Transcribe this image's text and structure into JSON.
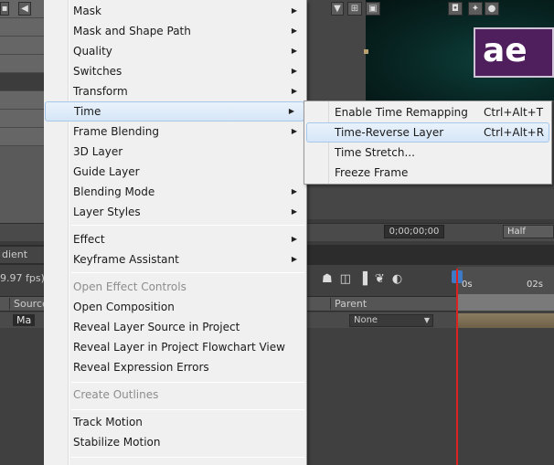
{
  "background": {
    "fps_label": "9.97 fps)",
    "panel_tab": "dient",
    "timecode": "0;00;00;00",
    "resolution": "Half",
    "columns": {
      "source": "Source",
      "parent": "Parent"
    },
    "layer_name": "Ma",
    "parent_value": "None",
    "ruler": {
      "start": "0s",
      "mark": "02s"
    },
    "logo_text": "ae"
  },
  "context_menu": {
    "items": [
      {
        "label": "Mask",
        "submenu": true
      },
      {
        "label": "Mask and Shape Path",
        "submenu": true
      },
      {
        "label": "Quality",
        "submenu": true
      },
      {
        "label": "Switches",
        "submenu": true
      },
      {
        "label": "Transform",
        "submenu": true
      },
      {
        "label": "Time",
        "submenu": true,
        "highlighted": true
      },
      {
        "label": "Frame Blending",
        "submenu": true
      },
      {
        "label": "3D Layer"
      },
      {
        "label": "Guide Layer"
      },
      {
        "label": "Blending Mode",
        "submenu": true
      },
      {
        "label": "Layer Styles",
        "submenu": true
      },
      {
        "label": "Effect",
        "submenu": true
      },
      {
        "label": "Keyframe Assistant",
        "submenu": true
      },
      {
        "label": "Open Effect Controls",
        "disabled": true
      },
      {
        "label": "Open Composition"
      },
      {
        "label": "Reveal Layer Source in Project"
      },
      {
        "label": "Reveal Layer in Project Flowchart View"
      },
      {
        "label": "Reveal Expression Errors"
      },
      {
        "label": "Create Outlines",
        "disabled": true
      },
      {
        "label": "Track Motion"
      },
      {
        "label": "Stabilize Motion"
      }
    ]
  },
  "time_submenu": {
    "items": [
      {
        "label": "Enable Time Remapping",
        "shortcut": "Ctrl+Alt+T"
      },
      {
        "label": "Time-Reverse Layer",
        "shortcut": "Ctrl+Alt+R",
        "highlighted": true
      },
      {
        "label": "Time Stretch...",
        "shortcut": ""
      },
      {
        "label": "Freeze Frame",
        "shortcut": ""
      }
    ]
  },
  "colors": {
    "menu_bg": "#f0f0f0",
    "highlight": "#d6e6f7",
    "highlight_border": "#a7c8eb",
    "playhead": "#dd2222"
  }
}
